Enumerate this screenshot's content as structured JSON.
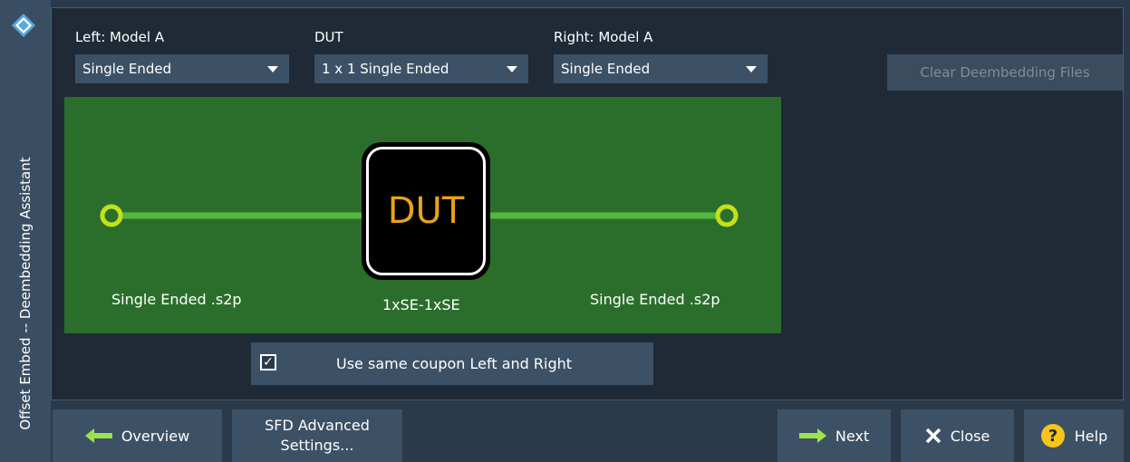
{
  "sidebar": {
    "title": "Offset Embed -- Deembedding Assistant"
  },
  "left_model": {
    "label": "Left: Model A",
    "value": "Single Ended"
  },
  "dut_model": {
    "label": "DUT",
    "value": "1 x 1 Single Ended"
  },
  "right_model": {
    "label": "Right: Model A",
    "value": "Single Ended"
  },
  "clear_button": {
    "label": "Clear Deembedding Files",
    "enabled": false
  },
  "diagram": {
    "dut_text": "DUT",
    "left_file": "Single Ended .s2p",
    "center_label": "1xSE-1xSE",
    "right_file": "Single Ended .s2p",
    "colors": {
      "background": "#2b6e2b",
      "line": "#55b83c",
      "port": "#c4e01a",
      "dut_text": "#e8a317"
    }
  },
  "coupon_option": {
    "label": "Use same coupon Left and Right",
    "checked": true
  },
  "footer": {
    "overview": "Overview",
    "sfd_line1": "SFD Advanced",
    "sfd_line2": "Settings...",
    "next": "Next",
    "close": "Close",
    "help": "Help"
  }
}
